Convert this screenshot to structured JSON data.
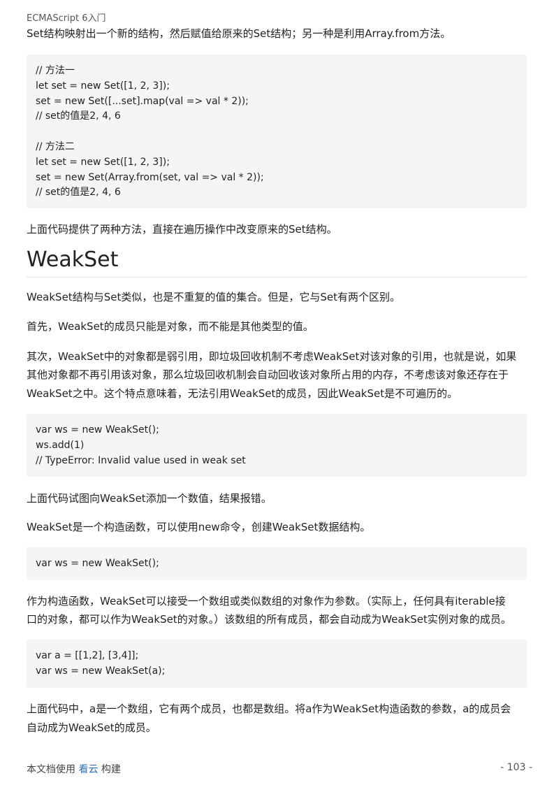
{
  "running_head": "ECMAScript 6入门",
  "intro_line": "Set结构映射出一个新的结构，然后赋值给原来的Set结构；另一种是利用Array.from方法。",
  "code1": [
    "// 方法一",
    "let set = new Set([1, 2, 3]);",
    "set = new Set([...set].map(val => val * 2));",
    "// set的值是2, 4, 6",
    "",
    "// 方法二",
    "let set = new Set([1, 2, 3]);",
    "set = new Set(Array.from(set, val => val * 2));",
    "// set的值是2, 4, 6"
  ],
  "p_after_code1": "上面代码提供了两种方法，直接在遍历操作中改变原来的Set结构。",
  "heading": "WeakSet",
  "p_weakset_intro": "WeakSet结构与Set类似，也是不重复的值的集合。但是，它与Set有两个区别。",
  "p_first": "首先，WeakSet的成员只能是对象，而不能是其他类型的值。",
  "p_second_lines": [
    "其次，WeakSet中的对象都是弱引用，即垃圾回收机制不考虑WeakSet对该对象的引用，也就是说，如果",
    "其他对象都不再引用该对象，那么垃圾回收机制会自动回收该对象所占用的内存，不考虑该对象还存在于",
    "WeakSet之中。这个特点意味着，无法引用WeakSet的成员，因此WeakSet是不可遍历的。"
  ],
  "code2": [
    "var ws = new WeakSet();",
    "ws.add(1)",
    "// TypeError: Invalid value used in weak set"
  ],
  "p_after_code2": "上面代码试图向WeakSet添加一个数值，结果报错。",
  "p_constructor": "WeakSet是一个构造函数，可以使用new命令，创建WeakSet数据结构。",
  "code3": [
    "var ws = new WeakSet();"
  ],
  "p_as_constructor_lines": [
    "作为构造函数，WeakSet可以接受一个数组或类似数组的对象作为参数。（实际上，任何具有iterable接",
    "口的对象，都可以作为WeakSet的对象。）该数组的所有成员，都会自动成为WeakSet实例对象的成员。"
  ],
  "code4": [
    "var a = [[1,2], [3,4]];",
    "var ws = new WeakSet(a);"
  ],
  "p_final_lines": [
    "上面代码中，a是一个数组，它有两个成员，也都是数组。将a作为WeakSet构造函数的参数，a的成员会",
    "自动成为WeakSet的成员。"
  ],
  "footer": {
    "prefix": "本文档使用",
    "brand": "看云",
    "suffix": "构建",
    "page_number": "- 103 -"
  },
  "colors": {
    "code_bg": "#f5f5f5",
    "brand_link": "#2d6fb4",
    "rule": "#e3e3e3"
  }
}
